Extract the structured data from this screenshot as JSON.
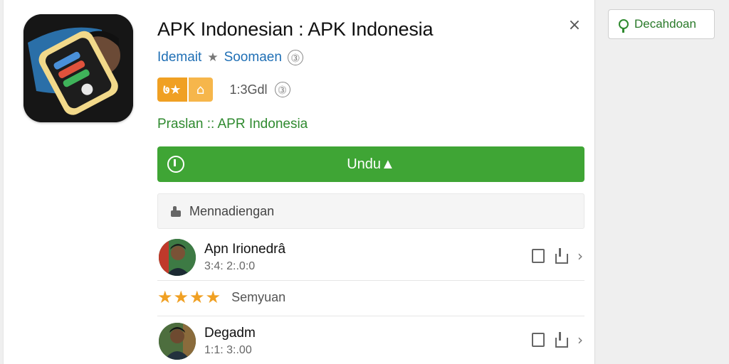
{
  "app": {
    "title": "APK Indonesian : APK Indonesia",
    "developer": "Idemait",
    "star_glyph": "★",
    "category": "Soomaen",
    "info_glyph": "⓷",
    "badge_left": "७★",
    "badge_right": "⌂",
    "size_text": "1:3Gdl",
    "size_info_glyph": "⓷",
    "green_label": "Praslan :: APR Indonesia",
    "icon_name": "app-wallet-icon"
  },
  "download": {
    "label": "Undu▲"
  },
  "section": {
    "label": "Mennadiengan"
  },
  "reviews": [
    {
      "name": "Apn Irionedrâ",
      "date": "3:4: 2:.0:0"
    },
    {
      "name": "Degadm",
      "date": "1:1: 3:.00"
    }
  ],
  "stars": {
    "glyphs": "★★★★",
    "label": "Semyuan"
  },
  "sidebar": {
    "button_label": "Decahdoan"
  },
  "close_glyph": "×",
  "chevron_glyph": "›",
  "colors": {
    "accent_green": "#3fa535",
    "link_blue": "#1f6fb5",
    "badge_orange": "#f0a023"
  }
}
